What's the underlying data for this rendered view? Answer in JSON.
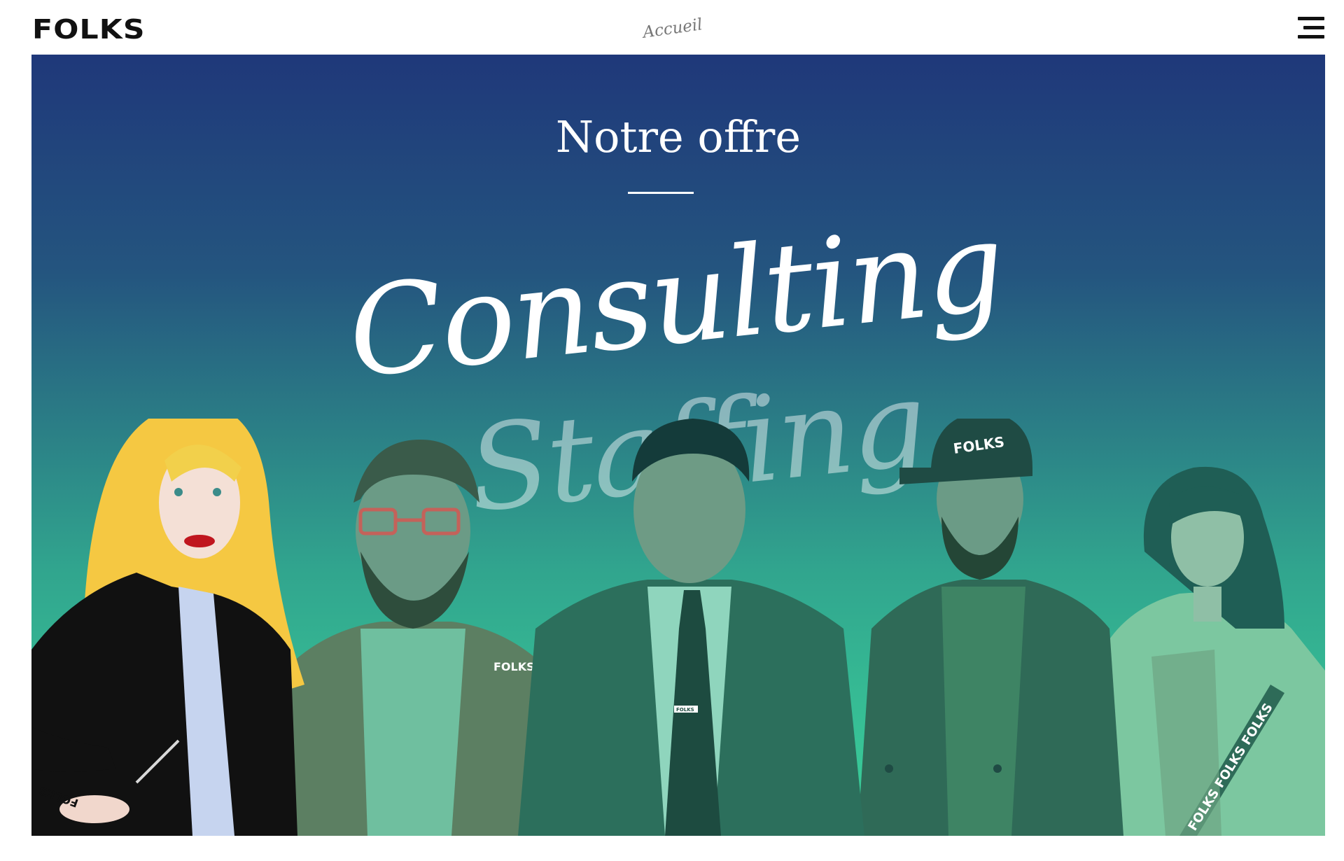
{
  "header": {
    "logo_text": "FOLKS",
    "home_link_text": "Accueil",
    "menu_icon": "hamburger-menu-icon"
  },
  "hero": {
    "title": "Notre offre",
    "offers": [
      {
        "label": "Consulting",
        "state": "active"
      },
      {
        "label": "Staffing",
        "state": "faded"
      }
    ],
    "illustration": {
      "people": [
        {
          "role": "woman-blonde",
          "badge": "FOLKS"
        },
        {
          "role": "man-bearded-glasses",
          "badge": "FOLKS"
        },
        {
          "role": "man-suit",
          "badge": "FOLKS"
        },
        {
          "role": "man-cap",
          "badge": "FOLKS"
        },
        {
          "role": "woman-headphones",
          "badge": "FOLKS FOLKS FOLKS"
        }
      ]
    }
  },
  "colors": {
    "gradient_top": "#1f387a",
    "gradient_bottom": "#3bd29a",
    "text_light": "#ffffff",
    "text_dark": "#111111"
  }
}
